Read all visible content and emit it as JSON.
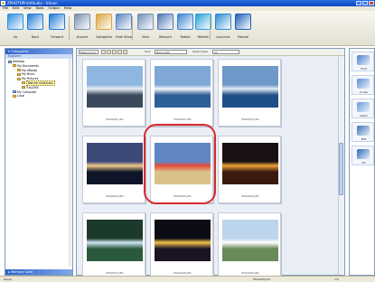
{
  "window": {
    "title": "ZPHOTOPrintStudio - Intuon"
  },
  "menu": [
    "File",
    "Edit",
    "View",
    "Tools",
    "Output",
    "Help"
  ],
  "toolbar": [
    {
      "id": "up",
      "label": "Up",
      "icon": "up-folder-icon",
      "color": "#2f8fe0"
    },
    {
      "id": "back",
      "label": "Back",
      "icon": "back-arrow-icon",
      "color": "#1f7bd8"
    },
    {
      "id": "forward",
      "label": "Forward",
      "icon": "forward-arrow-icon",
      "color": "#1f7bd8"
    },
    {
      "id": "acquire",
      "label": "Acquire",
      "icon": "scanner-icon",
      "color": "#7a8fa8"
    },
    {
      "id": "categories",
      "label": "Categories",
      "icon": "categories-icon",
      "color": "#d9a441"
    },
    {
      "id": "slide-show",
      "label": "Slide Show",
      "icon": "slideshow-icon",
      "color": "#5a86c4"
    },
    {
      "id": "view",
      "label": "View",
      "icon": "view-icon",
      "color": "#6f8fb8"
    },
    {
      "id": "retouch",
      "label": "Retouch",
      "icon": "retouch-icon",
      "color": "#4c77b5"
    },
    {
      "id": "rotate",
      "label": "Rotate",
      "icon": "rotate-icon",
      "color": "#3a84d0"
    },
    {
      "id": "refresh",
      "label": "Refresh",
      "icon": "refresh-icon",
      "color": "#2aa0d9"
    },
    {
      "id": "launcher",
      "label": "Launcher",
      "icon": "launcher-icon",
      "color": "#2a8bd0"
    },
    {
      "id": "manual",
      "label": "Manual",
      "icon": "help-question-icon",
      "color": "#1f5fb8"
    }
  ],
  "categories": {
    "title": "Categories",
    "subheader": "Explorer",
    "memory_card": "Memory Card",
    "tree": [
      {
        "label": "Desktop",
        "depth": 0,
        "type": "pc"
      },
      {
        "label": "My Documents",
        "depth": 1,
        "type": "folder"
      },
      {
        "label": "My eBooks",
        "depth": 2,
        "type": "folder"
      },
      {
        "label": "My Music",
        "depth": 2,
        "type": "folder"
      },
      {
        "label": "My Pictures",
        "depth": 2,
        "type": "folder"
      },
      {
        "label": "Nature Collection",
        "depth": 3,
        "type": "folder",
        "selected": true
      },
      {
        "label": "Trip2005",
        "depth": 3,
        "type": "folder"
      },
      {
        "label": "My Computer",
        "depth": 1,
        "type": "pc"
      },
      {
        "label": "Local",
        "depth": 1,
        "type": "folder"
      }
    ]
  },
  "viewbar": {
    "folder_field": "Nature Coll.",
    "sort_label": "Sort",
    "sort_value": "Name Ext",
    "select_label": "Select type",
    "select_value": "All"
  },
  "thumbnails": [
    {
      "caption": "IMG0001.JPG",
      "sky": "#8fb6e0",
      "ground": "#3a4a5c",
      "accent": "#e8eef5"
    },
    {
      "caption": "IMG0002.JPG",
      "sky": "#7fa8d6",
      "ground": "#2f5f98",
      "accent": "#f3f6fa"
    },
    {
      "caption": "IMG0003.JPG",
      "sky": "#6e98c8",
      "ground": "#1e4f86",
      "accent": "#dfe9f2"
    },
    {
      "caption": "IMG0004.JPG",
      "sky": "#3d4a78",
      "ground": "#0f1528",
      "accent": "#f0c98a"
    },
    {
      "caption": "IMG0005.JPG",
      "sky": "#5f86c2",
      "ground": "#d8c28a",
      "accent": "#e84c3a"
    },
    {
      "caption": "IMG0006.JPG",
      "sky": "#1a1212",
      "ground": "#3a1a10",
      "accent": "#f0a23a"
    },
    {
      "caption": "IMG0007.JPG",
      "sky": "#1c3a2c",
      "ground": "#2a5a3e",
      "accent": "#cfe4f2"
    },
    {
      "caption": "IMG0008.JPG",
      "sky": "#0c0c14",
      "ground": "#1a1424",
      "accent": "#f2c24a"
    },
    {
      "caption": "IMG0009.JPG",
      "sky": "#bcd4ec",
      "ground": "#6a8a5a",
      "accent": "#ffffff"
    }
  ],
  "right_panel": [
    {
      "label": "Print",
      "icon": "print-icon",
      "color": "#4a7fc8"
    },
    {
      "label": "E-mail",
      "icon": "email-icon",
      "color": "#5c90d4"
    },
    {
      "label": "Album",
      "icon": "album-icon",
      "color": "#6d9ad8"
    },
    {
      "label": "PDF",
      "icon": "pdf-icon",
      "color": "#3f6fb6"
    },
    {
      "label": "CD",
      "icon": "cd-icon",
      "color": "#2f66b8"
    }
  ],
  "status": {
    "left": "Ready",
    "middle": "IMG0005.JPG",
    "right": "1/9"
  },
  "colors": {
    "highlight": "#d82a2a",
    "panel_header": "#2c63c9"
  }
}
